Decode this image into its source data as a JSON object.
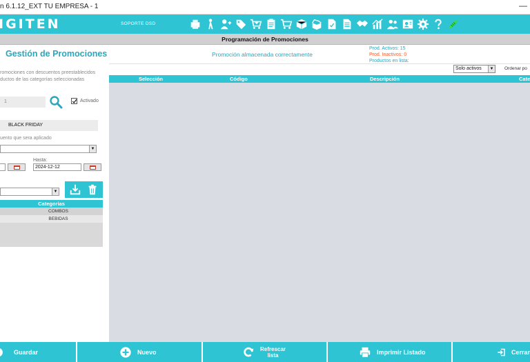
{
  "window": {
    "title": "n 6.1.12_EXT TU EMPRESA - 1",
    "minimize": "—"
  },
  "brand": {
    "logo": "IGITEN",
    "support": "SOPORTE DSD"
  },
  "toolbar": {
    "icons": [
      "printer-icon",
      "person-walk-icon",
      "user-add-icon",
      "tag-icon",
      "cart-add-icon",
      "clipboard-icon",
      "cart-icon",
      "box-icon",
      "box-open-icon",
      "document-check-icon",
      "document-list-icon",
      "handshake-icon",
      "chart-icon",
      "users-icon",
      "id-card-icon",
      "gear-icon",
      "help-icon",
      "pencil-icon"
    ]
  },
  "header": {
    "title": "Programación de Promociones"
  },
  "page": {
    "title": "Gestión de Promociones",
    "status": "Promoción almacenada correctamente",
    "stats": {
      "active": "Prod. Activos: 15",
      "inactive": "Prod. Inactivos: 0",
      "listed": "Productos en lista:"
    }
  },
  "form": {
    "description_line1": "romociones con descuentos preestablecidos",
    "description_line2": "ductos de las categorías seleccionadas",
    "code": "1",
    "active_label": "Activado",
    "active": true,
    "name": "BLACK FRIDAY",
    "discount_label": "uento que sera aplicado",
    "to_label": "Hasta:",
    "to_date": "2024-12-12"
  },
  "categories": {
    "header": "Categorias",
    "items": [
      "COMBOS",
      "BEBIDAS"
    ]
  },
  "grid": {
    "filter": "Solo activos",
    "order_label": "Ordenar po",
    "columns": [
      "Selección",
      "Código",
      "Descripción",
      "Cate"
    ]
  },
  "actions": {
    "save": "Guardar",
    "new": "Nuevo",
    "refresh_line1": "Refrescar",
    "refresh_line2": "lista",
    "print": "Imprimir Listado",
    "close": "Cerrar"
  },
  "colors": {
    "accent": "#2ec4d4",
    "title": "#2aa6bd",
    "warning": "#ff5a2a",
    "grid_bg": "#d9dce2"
  }
}
